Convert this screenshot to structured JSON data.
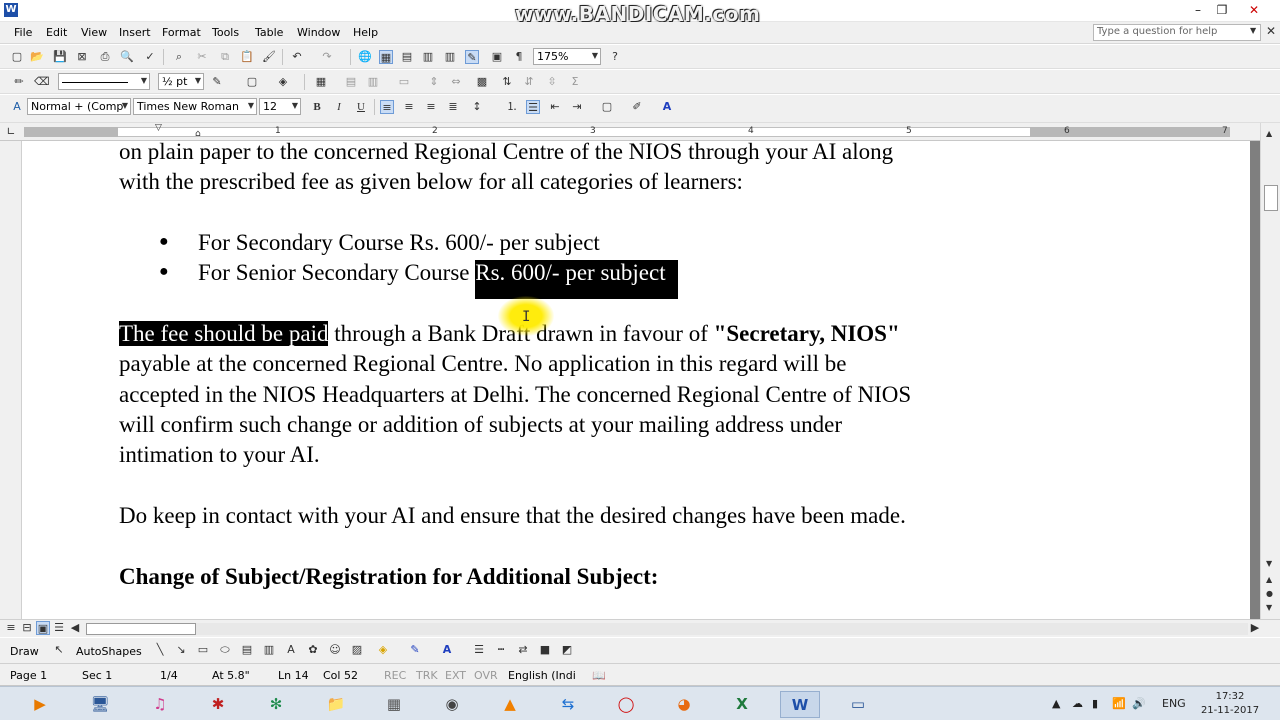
{
  "window": {
    "app_icon_letter": "W",
    "watermark": "www.BANDICAM.com",
    "minimize": "–",
    "restore": "❐",
    "close": "✕"
  },
  "menu": {
    "items": [
      "File",
      "Edit",
      "View",
      "Insert",
      "Format",
      "Tools",
      "Table",
      "Window",
      "Help"
    ],
    "help_placeholder": "Type a question for help"
  },
  "toolbar": {
    "zoom": "175%",
    "line_weight": "½ pt",
    "style": "Normal + (Comp",
    "font": "Times New Roman",
    "font_size": "12"
  },
  "ruler": {
    "numbers": [
      "1",
      "2",
      "3",
      "4",
      "5",
      "6",
      "7"
    ]
  },
  "document": {
    "line1": "on plain paper to the concerned Regional Centre of the NIOS through your AI along",
    "line2": "with the prescribed fee as given below for all categories of learners:",
    "bullet1": "For Secondary Course Rs. 600/- per subject",
    "bullet2_prefix": "For Senior Secondary Course ",
    "bullet2_selected": "Rs. 600/- per subject",
    "para_selected": "The fee should be paid",
    "para_rest": " through a Bank Draft drawn in favour of ",
    "para_bold": "\"Secretary, NIOS\"",
    "line4": "payable at the concerned Regional Centre. No application in this regard will be",
    "line5": "accepted in the NIOS Headquarters at Delhi. The concerned Regional Centre of NIOS",
    "line6": "will confirm such change or addition of subjects at your mailing address under",
    "line7": "intimation to your AI.",
    "line8": "Do keep in contact with your AI and ensure that the desired changes have been made.",
    "heading": "Change of Subject/Registration for Additional Subject:",
    "bullet_glyph": "●"
  },
  "drawing": {
    "draw_label": "Draw",
    "autoshapes_label": "AutoShapes"
  },
  "status": {
    "page": "Page 1",
    "sec": "Sec 1",
    "pages": "1/4",
    "at": "At 5.8\"",
    "ln": "Ln 14",
    "col": "Col 52",
    "rec": "REC",
    "trk": "TRK",
    "ext": "EXT",
    "ovr": "OVR",
    "language": "English (Indi"
  },
  "taskbar": {
    "lang": "ENG",
    "time": "17:32",
    "date": "21-11-2017"
  },
  "colors": {
    "selection": "#000000",
    "taskbar": "#dde5ee",
    "cursor_highlight": "#ffeb00"
  }
}
